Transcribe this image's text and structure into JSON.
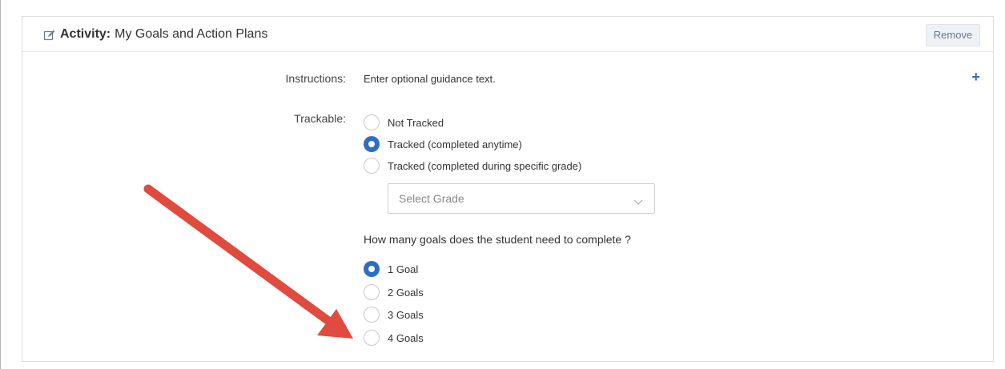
{
  "header": {
    "title_prefix": "Activity:",
    "title": "My Goals and Action Plans",
    "remove_label": "Remove"
  },
  "instructions": {
    "label": "Instructions:",
    "text": "Enter optional guidance text."
  },
  "trackable": {
    "label": "Trackable:",
    "options": [
      {
        "label": "Not Tracked",
        "selected": false
      },
      {
        "label": "Tracked (completed anytime)",
        "selected": true
      },
      {
        "label": "Tracked (completed during specific grade)",
        "selected": false
      }
    ],
    "grade_select": "Select Grade"
  },
  "goals": {
    "question": "How many goals does the student need to complete ?",
    "options": [
      {
        "label": "1 Goal",
        "selected": true
      },
      {
        "label": "2 Goals",
        "selected": false
      },
      {
        "label": "3 Goals",
        "selected": false
      },
      {
        "label": "4 Goals",
        "selected": false
      }
    ]
  },
  "colors": {
    "accent": "#2f6cc4",
    "annotation_arrow": "#e04a3f"
  }
}
